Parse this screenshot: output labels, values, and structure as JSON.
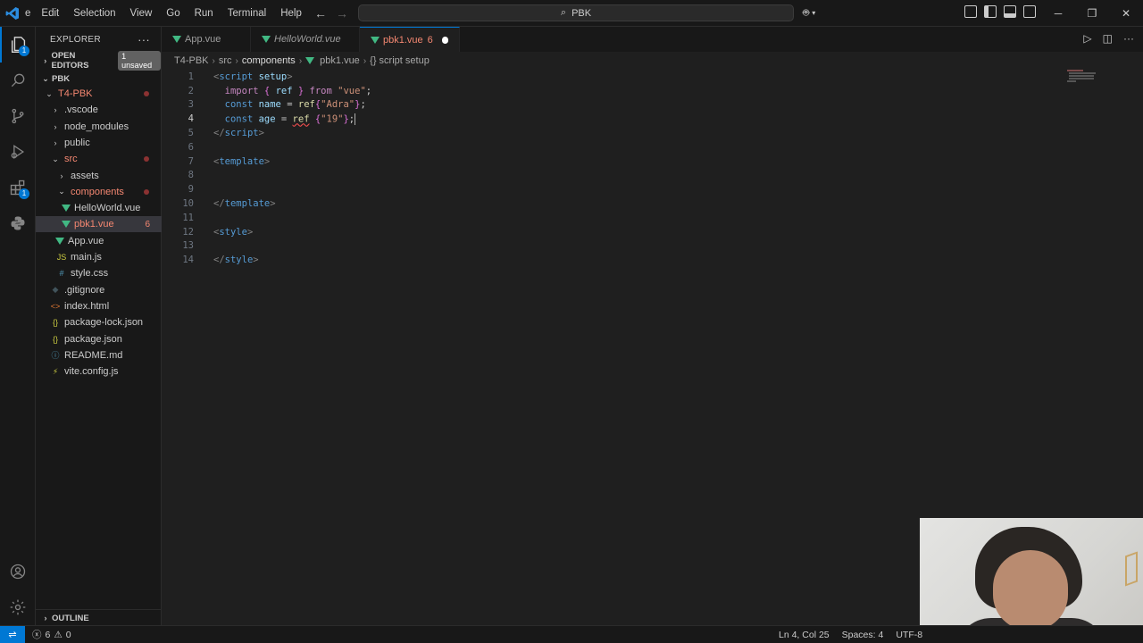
{
  "titlebar": {
    "menu_partial": "e",
    "menu": [
      "Edit",
      "Selection",
      "View",
      "Go",
      "Run",
      "Terminal",
      "Help"
    ],
    "search_text": "PBK"
  },
  "activitybar": {
    "icons": [
      "explorer-icon",
      "search-icon",
      "source-control-icon",
      "run-debug-icon",
      "extensions-icon",
      "python-icon",
      "account-icon",
      "manage-gear-icon"
    ],
    "explorer_badge": "1",
    "extensions_badge": "1"
  },
  "sidebar": {
    "title": "EXPLORER",
    "more": "···",
    "open_editors": "OPEN EDITORS",
    "unsaved": "1 unsaved",
    "workspace": "PBK",
    "tree": [
      {
        "label": "T4-PBK",
        "type": "folder-open",
        "indent": 0,
        "modified": "dot"
      },
      {
        "label": ".vscode",
        "type": "folder",
        "indent": 1
      },
      {
        "label": "node_modules",
        "type": "folder",
        "indent": 1
      },
      {
        "label": "public",
        "type": "folder",
        "indent": 1
      },
      {
        "label": "src",
        "type": "folder-open",
        "indent": 1,
        "modified": "dot"
      },
      {
        "label": "assets",
        "type": "folder",
        "indent": 2
      },
      {
        "label": "components",
        "type": "folder-open",
        "indent": 2,
        "modified": "dot"
      },
      {
        "label": "HelloWorld.vue",
        "type": "vue",
        "indent": 3
      },
      {
        "label": "pbk1.vue",
        "type": "vue",
        "indent": 3,
        "modified": "6",
        "selected": true
      },
      {
        "label": "App.vue",
        "type": "vue",
        "indent": 2
      },
      {
        "label": "main.js",
        "type": "js",
        "indent": 2
      },
      {
        "label": "style.css",
        "type": "css",
        "indent": 2
      },
      {
        "label": ".gitignore",
        "type": "git",
        "indent": 1
      },
      {
        "label": "index.html",
        "type": "html",
        "indent": 1
      },
      {
        "label": "package-lock.json",
        "type": "json",
        "indent": 1
      },
      {
        "label": "package.json",
        "type": "json",
        "indent": 1
      },
      {
        "label": "README.md",
        "type": "info",
        "indent": 1
      },
      {
        "label": "vite.config.js",
        "type": "vite",
        "indent": 1
      }
    ],
    "outline": "OUTLINE"
  },
  "tabs": [
    {
      "label": "App.vue"
    },
    {
      "label": "HelloWorld.vue"
    },
    {
      "label": "pbk1.vue",
      "count": "6"
    }
  ],
  "breadcrumbs": [
    "T4-PBK",
    "src",
    "components",
    "pbk1.vue",
    "{} script setup"
  ],
  "editor": {
    "line_numbers": [
      "1",
      "2",
      "3",
      "4",
      "5",
      "6",
      "7",
      "8",
      "9",
      "10",
      "11",
      "12",
      "13",
      "14"
    ],
    "active_line": "4"
  },
  "statusbar": {
    "errors": "6",
    "warnings": "0",
    "position": "Ln 4, Col 25",
    "spaces": "Spaces: 4",
    "encoding": "UTF-8"
  }
}
